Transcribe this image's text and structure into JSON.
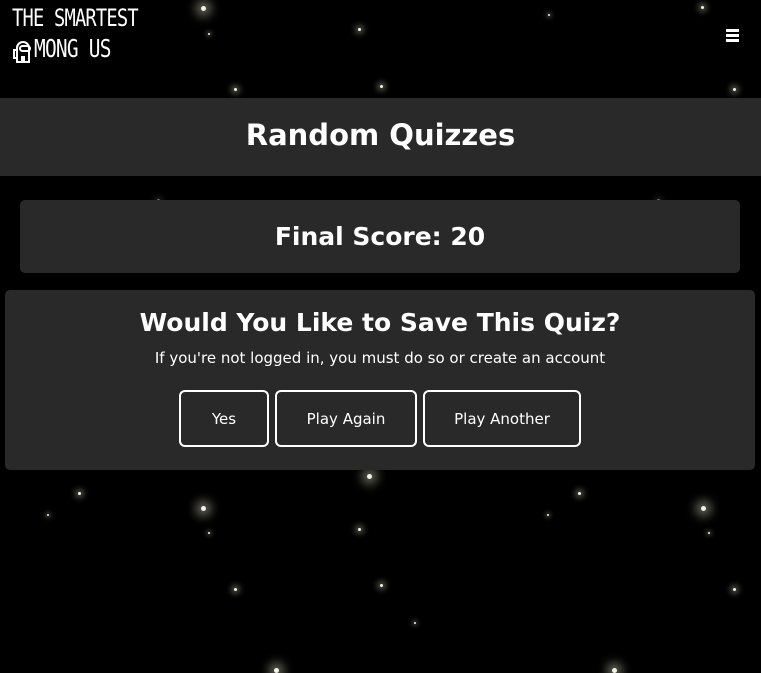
{
  "logo": {
    "line1": "THE SMARTEST",
    "line2": "MONG US"
  },
  "menu": {
    "icon": "hamburger-menu-icon"
  },
  "header": {
    "title": "Random Quizzes"
  },
  "score": {
    "label": "Final Score: 20"
  },
  "save_prompt": {
    "heading": "Would You Like to Save This Quiz?",
    "subtitle": "If you're not logged in, you must do so or create an account",
    "buttons": {
      "yes": "Yes",
      "play_again": "Play Again",
      "play_another": "Play Another"
    }
  },
  "colors": {
    "background": "#000000",
    "panel": "#292929",
    "text": "#ffffff"
  }
}
